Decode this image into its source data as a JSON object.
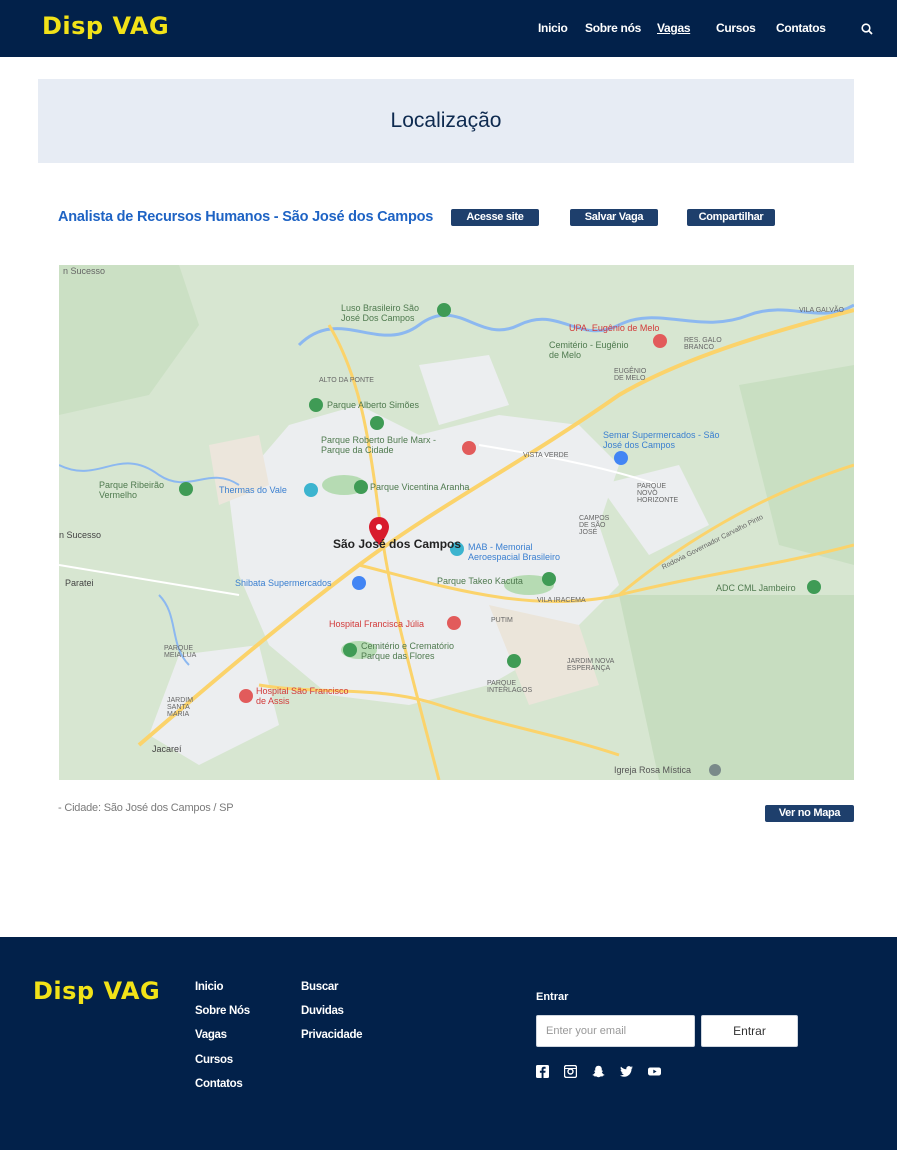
{
  "brand": {
    "name": "Disp VAG",
    "accent": "#f2e218",
    "navy": "#02214a"
  },
  "nav": {
    "items": [
      {
        "label": "Inicio"
      },
      {
        "label": "Sobre nós"
      },
      {
        "label": "Vagas"
      },
      {
        "label": "Cursos"
      },
      {
        "label": "Contatos"
      }
    ],
    "search_icon": "search-icon"
  },
  "page": {
    "title": "Localização"
  },
  "job": {
    "title": "Analista de Recursos Humanos - São José dos Campos",
    "buttons": {
      "access": "Acesse site",
      "save": "Salvar Vaga",
      "share": "Compartilhar"
    },
    "city_line": "- Cidade: São José dos Campos / SP",
    "map_button": "Ver no Mapa"
  },
  "map": {
    "labels": {
      "city": "São José dos Campos",
      "luso": "Luso Brasileiro São José Dos Campos",
      "upa": "UPA. Eugênio de Melo",
      "cemiterio_eugenio": "Cemitério - Eugênio de Melo",
      "parque_alberto": "Parque Alberto Simões",
      "parque_roberto": "Parque Roberto Burle Marx - Parque da Cidade",
      "semar": "Semar Supermercados - São José dos Campos",
      "parque_ribeirao": "Parque Ribeirão Vermelho",
      "thermas": "Thermas do Vale",
      "parque_vicentina": "Parque Vicentina Aranha",
      "mab": "MAB - Memorial Aeroespacial Brasileiro",
      "shibata": "Shibata Supermercados",
      "parque_takeo": "Parque Takeo Kacuta",
      "adc": "ADC CML Jambeiro",
      "hospital_francisca": "Hospital Francisca Júlia",
      "cemiterio_flores": "Cemitério e Crematório Parque das Flores",
      "hospital_sao_francisco": "Hospital São Francisco de Assis",
      "igreja": "Igreja Rosa Mística",
      "jacarei": "Jacareí",
      "paratei": "Paratei",
      "sucesso": "n Sucesso",
      "alto_ponte": "ALTO DA PONTE",
      "eugenio_melo": "EUGÊNIO DE MELO",
      "vila_galvao": "VILA GALVÃO",
      "res_galo": "RES. GALO BRANCO",
      "vista_verde": "VISTA VERDE",
      "parque_novo": "PARQUE NOVO HORIZONTE",
      "campos_sao_jose": "CAMPOS DE SÃO JOSÉ",
      "vila_iracema": "VILA IRACEMA",
      "putim": "PUTIM",
      "jardim_santa": "JARDIM SANTA MARIA",
      "parque_meia_lua": "PARQUE MEIA LUA",
      "parque_interlagos": "PARQUE INTERLAGOS",
      "jardim_nova": "JARDIM NOVA ESPERANÇA",
      "rodovia": "Rodovia Governador Carvalho Pinto"
    },
    "colors": {
      "land": "#dbe8d7",
      "urban": "#eef0f2",
      "road": "#fbd36b",
      "water": "#8cb8f0",
      "park": "#bfe0bd"
    }
  },
  "footer": {
    "col1": [
      {
        "label": "Inicio"
      },
      {
        "label": "Sobre Nós"
      },
      {
        "label": "Vagas"
      },
      {
        "label": "Cursos"
      },
      {
        "label": "Contatos"
      }
    ],
    "col2": [
      {
        "label": "Buscar"
      },
      {
        "label": "Duvidas"
      },
      {
        "label": "Privacidade"
      }
    ],
    "login_label": "Entrar",
    "email_placeholder": "Enter your email",
    "login_button": "Entrar",
    "social": [
      "facebook-icon",
      "instagram-icon",
      "snapchat-icon",
      "twitter-icon",
      "youtube-icon"
    ]
  }
}
